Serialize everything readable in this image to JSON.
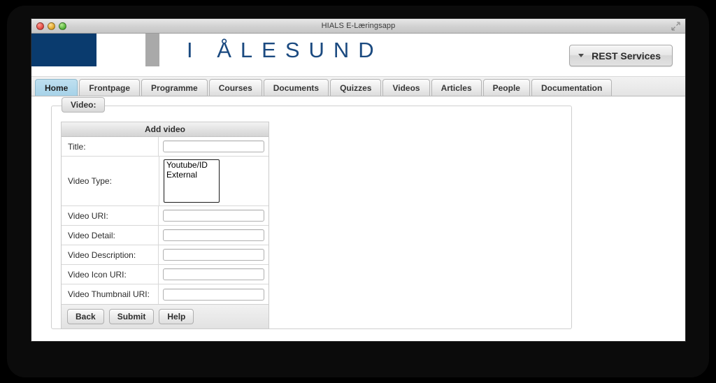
{
  "window": {
    "title": "HIALS E-Læringsapp",
    "traffic_lights": [
      "close-button",
      "minimize-button",
      "zoom-button"
    ],
    "resize_icon": "resize-icon"
  },
  "header": {
    "logo_text": "I ÅLESUND",
    "logo_block_color": "#0a3b6e",
    "logo_bar_color": "#a9a9a9",
    "logo_text_color": "#1b4a80",
    "rest_button": {
      "label": "REST Services",
      "caret_icon": "chevron-down-icon"
    }
  },
  "nav": {
    "active_tab": "Home",
    "active_color": "#a6d2e8",
    "tabs": [
      {
        "label": "Home"
      },
      {
        "label": "Frontpage"
      },
      {
        "label": "Programme"
      },
      {
        "label": "Courses"
      },
      {
        "label": "Documents"
      },
      {
        "label": "Quizzes"
      },
      {
        "label": "Videos"
      },
      {
        "label": "Articles"
      },
      {
        "label": "People"
      },
      {
        "label": "Documentation"
      }
    ]
  },
  "form": {
    "legend": "Video:",
    "table_title": "Add video",
    "rows": [
      {
        "label": "Title:",
        "type": "text",
        "value": ""
      },
      {
        "label": "Video Type:",
        "type": "select",
        "options": [
          "Youtube/ID",
          "External"
        ]
      },
      {
        "label": "Video URI:",
        "type": "text",
        "value": ""
      },
      {
        "label": "Video Detail:",
        "type": "text",
        "value": ""
      },
      {
        "label": "Video Description:",
        "type": "text",
        "value": ""
      },
      {
        "label": "Video Icon URI:",
        "type": "text",
        "value": ""
      },
      {
        "label": "Video Thumbnail URI:",
        "type": "text",
        "value": ""
      }
    ],
    "buttons": [
      {
        "label": "Back"
      },
      {
        "label": "Submit"
      },
      {
        "label": "Help"
      }
    ]
  }
}
